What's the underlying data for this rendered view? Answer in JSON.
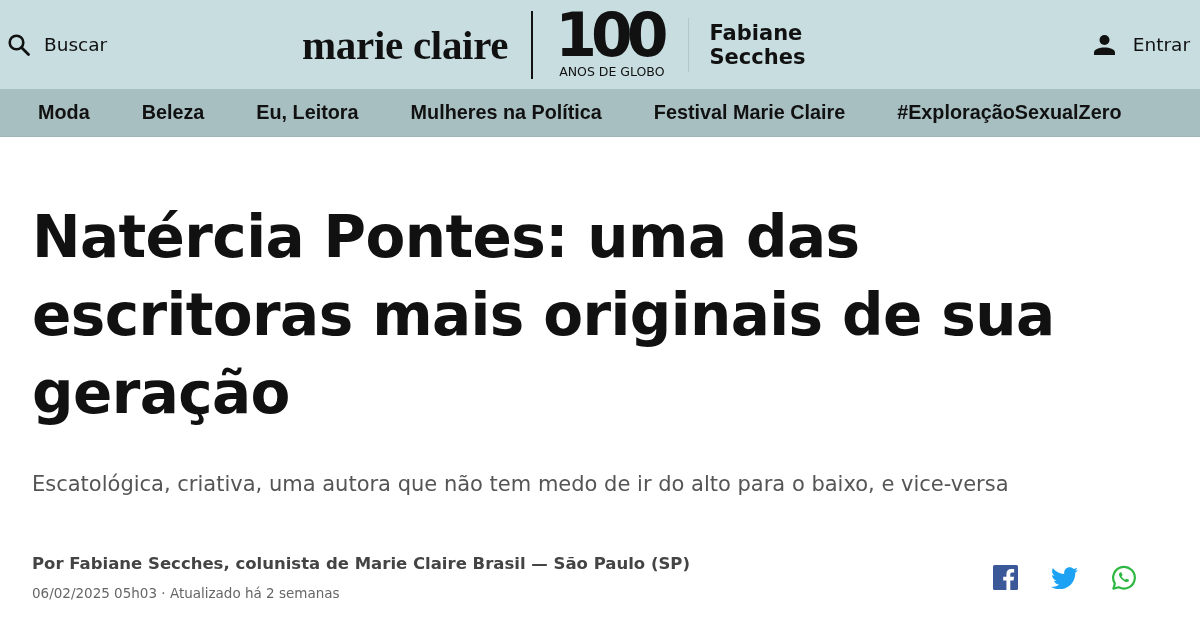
{
  "header": {
    "search": {
      "label": "Buscar"
    },
    "logo": {
      "wordmark": "marie claire",
      "anniversary_number": "100",
      "anniversary_caption": "ANOS DE GLOBO"
    },
    "column_name": "Fabiane Secches",
    "login": {
      "label": "Entrar"
    }
  },
  "nav": {
    "items": [
      {
        "label": "Moda"
      },
      {
        "label": "Beleza"
      },
      {
        "label": "Eu, Leitora"
      },
      {
        "label": "Mulheres na Política"
      },
      {
        "label": "Festival Marie Claire"
      },
      {
        "label": "#ExploraçãoSexualZero"
      }
    ]
  },
  "article": {
    "title": "Natércia Pontes: uma das escritoras mais originais de sua geração",
    "subtitle": "Escatológica, criativa, uma autora que não tem medo de ir do alto para o baixo, e vice-versa",
    "byline": "Por Fabiane Secches, colunista de Marie Claire Brasil — São Paulo (SP)",
    "timestamp": "06/02/2025 05h03 · Atualizado há 2 semanas",
    "share_buttons": [
      {
        "kind": "facebook"
      },
      {
        "kind": "twitter"
      },
      {
        "kind": "whatsapp"
      }
    ]
  }
}
